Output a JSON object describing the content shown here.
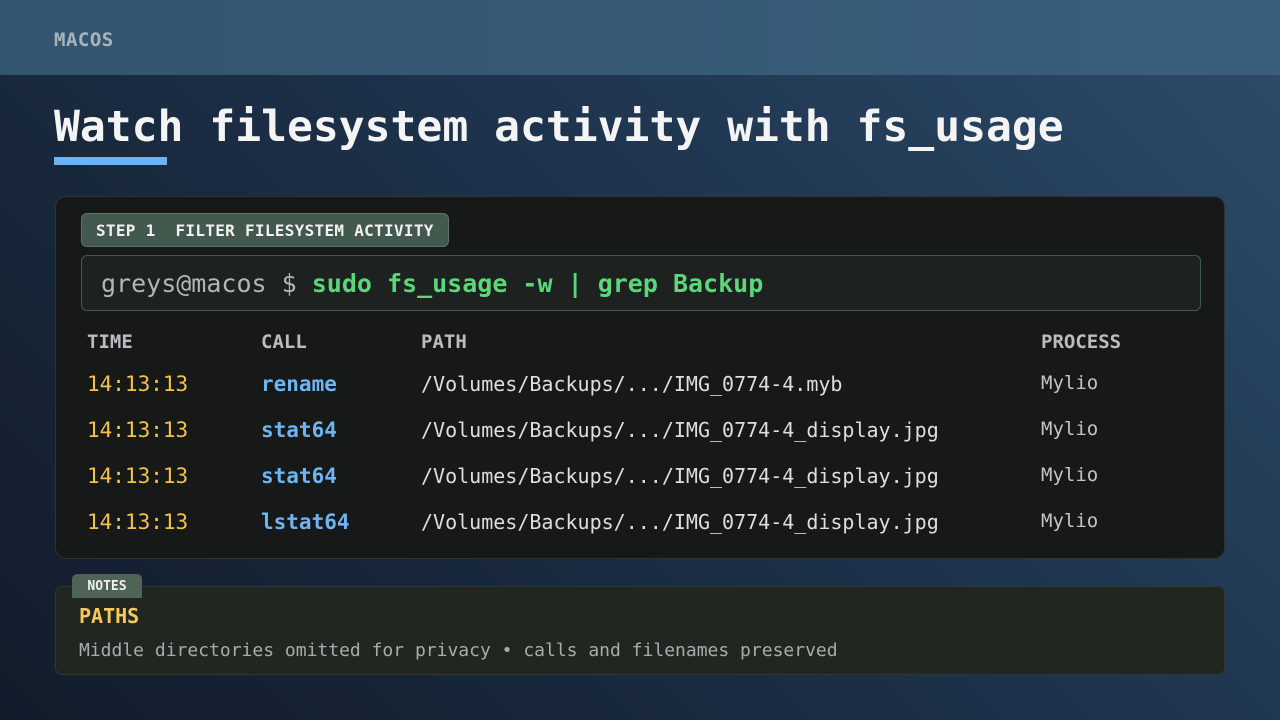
{
  "topbar": {
    "brand": "MACOS"
  },
  "page": {
    "title": "Watch filesystem activity with fs_usage"
  },
  "terminal": {
    "step_label": "STEP 1  FILTER FILESYSTEM ACTIVITY",
    "prompt": "greys@macos $ ",
    "command": "sudo fs_usage -w | grep Backup",
    "columns": {
      "time": "TIME",
      "call": "CALL",
      "path": "PATH",
      "process": "PROCESS"
    },
    "rows": [
      {
        "time": "14:13:13",
        "call": "rename",
        "path": "/Volumes/Backups/.../IMG_0774-4.myb",
        "process": "Mylio"
      },
      {
        "time": "14:13:13",
        "call": "stat64",
        "path": "/Volumes/Backups/.../IMG_0774-4_display.jpg",
        "process": "Mylio"
      },
      {
        "time": "14:13:13",
        "call": "stat64",
        "path": "/Volumes/Backups/.../IMG_0774-4_display.jpg",
        "process": "Mylio"
      },
      {
        "time": "14:13:13",
        "call": "lstat64",
        "path": "/Volumes/Backups/.../IMG_0774-4_display.jpg",
        "process": "Mylio"
      }
    ]
  },
  "notes": {
    "tab_label": "NOTES",
    "heading": "PATHS",
    "text": "Middle directories omitted for privacy • calls and filenames preserved"
  },
  "colors": {
    "accent": "#6cb2f5",
    "command": "#5bd67a",
    "time": "#f3c24b",
    "call": "#6db4f2",
    "notes_heading": "#f6c85a"
  }
}
